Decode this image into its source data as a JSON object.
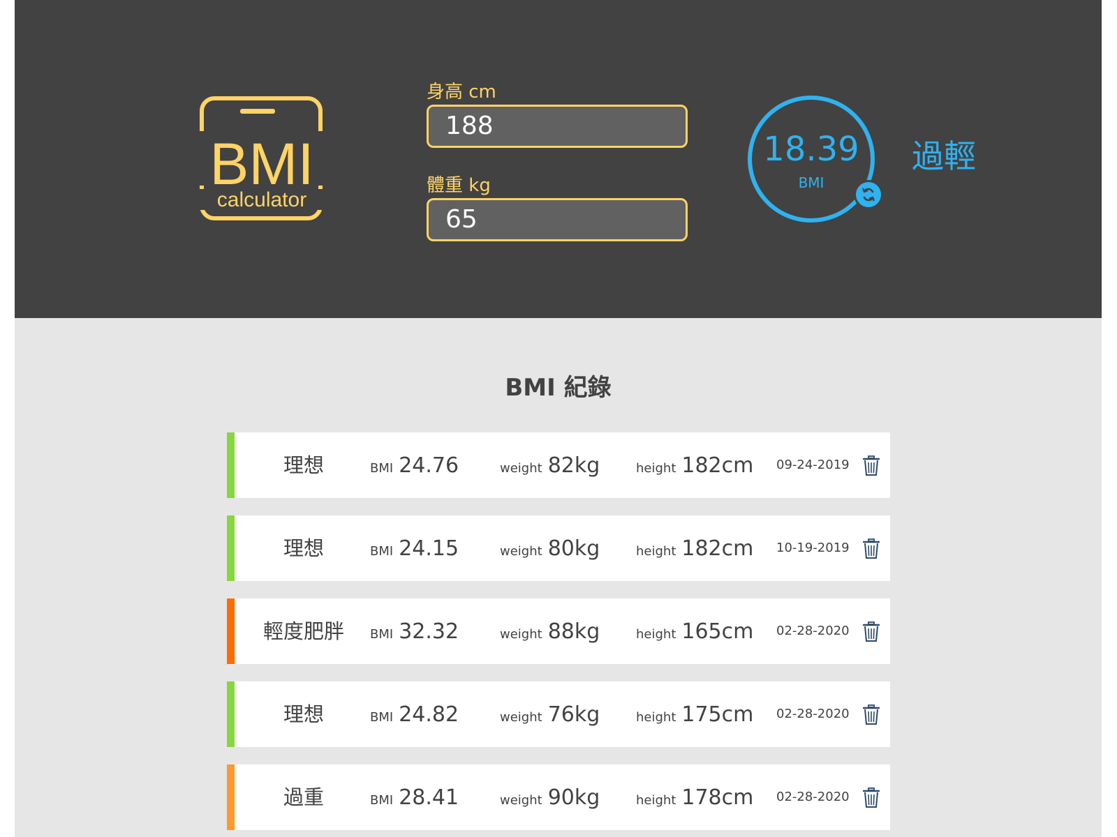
{
  "logo": {
    "title": "BMI",
    "subtitle": "calculator"
  },
  "form": {
    "height_label": "身高 cm",
    "height_value": "188",
    "weight_label": "體重 kg",
    "weight_value": "65"
  },
  "result": {
    "value": "18.39",
    "unit": "BMI",
    "status": "過輕",
    "reset_icon": "refresh-icon"
  },
  "colors": {
    "accent_yellow": "#ffd366",
    "accent_blue": "#2fb2f0",
    "ideal": "#86d73e",
    "overweight": "#ff982d",
    "mild_obese": "#ff6c02"
  },
  "records": {
    "title": "BMI 紀錄",
    "bmi_key": "BMI",
    "weight_key": "weight",
    "height_key": "height",
    "items": [
      {
        "status": "理想",
        "color": "#86d73e",
        "bmi": "24.76",
        "weight": "82kg",
        "height": "182cm",
        "date": "09-24-2019"
      },
      {
        "status": "理想",
        "color": "#86d73e",
        "bmi": "24.15",
        "weight": "80kg",
        "height": "182cm",
        "date": "10-19-2019"
      },
      {
        "status": "輕度肥胖",
        "color": "#ff6c02",
        "bmi": "32.32",
        "weight": "88kg",
        "height": "165cm",
        "date": "02-28-2020"
      },
      {
        "status": "理想",
        "color": "#86d73e",
        "bmi": "24.82",
        "weight": "76kg",
        "height": "175cm",
        "date": "02-28-2020"
      },
      {
        "status": "過重",
        "color": "#ff982d",
        "bmi": "28.41",
        "weight": "90kg",
        "height": "178cm",
        "date": "02-28-2020"
      }
    ]
  }
}
